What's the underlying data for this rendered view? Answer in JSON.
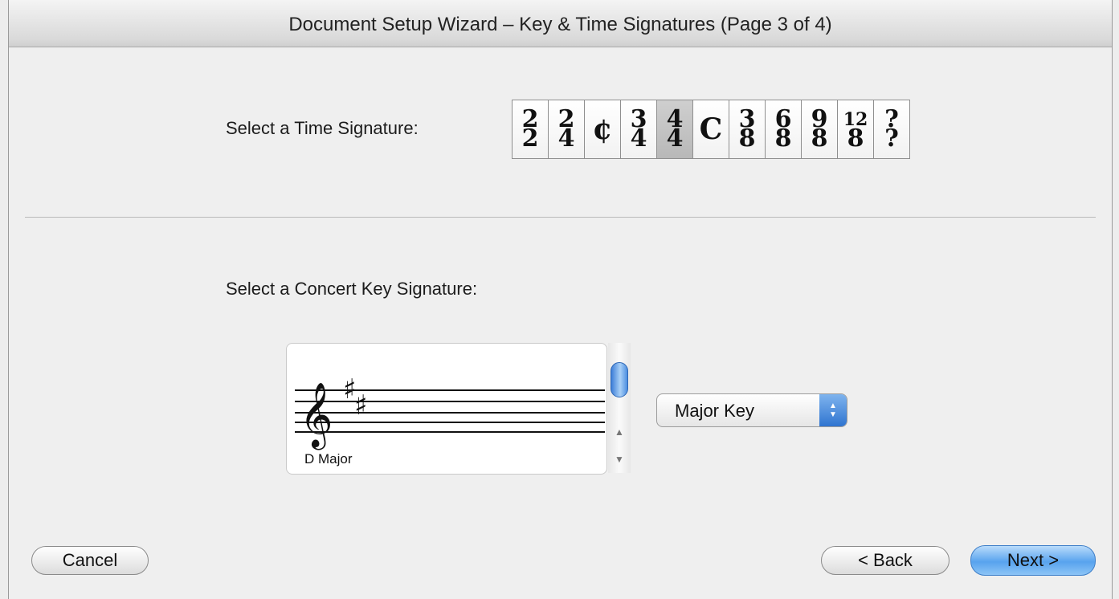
{
  "window": {
    "title": "Document Setup Wizard – Key & Time Signatures (Page 3 of 4)"
  },
  "time_signature": {
    "label": "Select a Time Signature:",
    "options": [
      {
        "num": "2",
        "den": "2"
      },
      {
        "num": "2",
        "den": "4"
      },
      {
        "symbol": "¢"
      },
      {
        "num": "3",
        "den": "4"
      },
      {
        "num": "4",
        "den": "4",
        "selected": true
      },
      {
        "symbol": "C"
      },
      {
        "num": "3",
        "den": "8"
      },
      {
        "num": "6",
        "den": "8"
      },
      {
        "num": "9",
        "den": "8"
      },
      {
        "num": "12",
        "den": "8"
      },
      {
        "num": "?",
        "den": "?"
      }
    ]
  },
  "key_signature": {
    "label": "Select a Concert Key Signature:",
    "preview_name": "D Major",
    "mode_select": "Major Key"
  },
  "buttons": {
    "cancel": "Cancel",
    "back": "< Back",
    "next": "Next >"
  }
}
